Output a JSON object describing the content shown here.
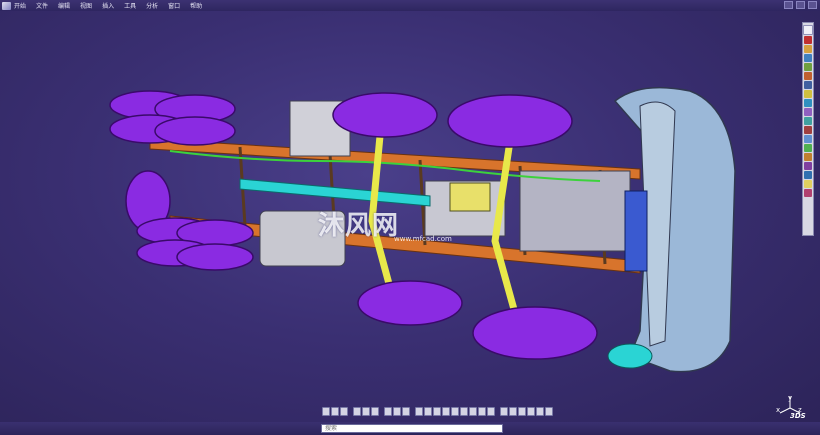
{
  "app": {
    "menu": [
      "开始",
      "文件",
      "编辑",
      "视图",
      "插入",
      "工具",
      "分析",
      "窗口",
      "帮助"
    ]
  },
  "watermark": {
    "text": "沐风网",
    "url": "www.mfcad.com"
  },
  "command": {
    "placeholder": "搜索",
    "value": ""
  },
  "compass": {
    "x": "x",
    "y": "y",
    "z": "z"
  },
  "brand": "3DS",
  "right_toolbar": {
    "icons": [
      "select-icon",
      "sketch-icon",
      "pad-icon",
      "pocket-icon",
      "shaft-icon",
      "groove-icon",
      "hole-icon",
      "rib-icon",
      "fillet-icon",
      "chamfer-icon",
      "draft-icon",
      "shell-icon",
      "mirror-icon",
      "pattern-icon",
      "measure-icon",
      "apply-material-icon",
      "render-icon",
      "light-icon",
      "part-design-icon"
    ]
  },
  "bottom_toolbar": {
    "icons": [
      "fly-mode-icon",
      "fit-all-icon",
      "pan-icon",
      "rotate-icon",
      "zoom-in-icon",
      "zoom-out-icon",
      "normal-view-icon",
      "quick-view-icon",
      "view-mode-icon",
      "hide-show-icon",
      "swap-space-icon",
      "iso-view-icon",
      "front-view-icon",
      "top-view-icon",
      "right-view-icon",
      "left-view-icon",
      "back-view-icon",
      "bottom-view-icon",
      "shading-icon",
      "wireframe-icon",
      "edges-icon",
      "perspective-icon",
      "material-icon",
      "layer-icon"
    ]
  },
  "colors": {
    "background": "#3a2f72",
    "tire": "#8a2be2",
    "frame_rail": "#e07a2e",
    "cab": "#9bb8d8",
    "driveshaft": "#2ad4d4",
    "suspension": "#e8e84a"
  }
}
